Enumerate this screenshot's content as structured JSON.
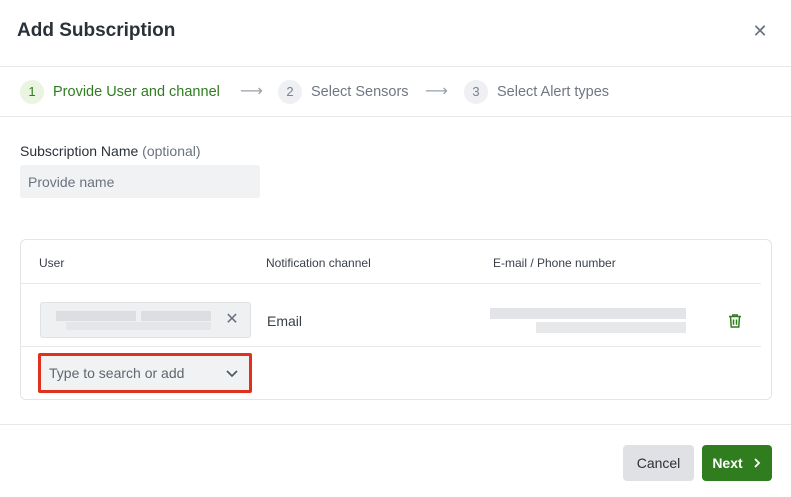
{
  "dialog": {
    "title": "Add Subscription",
    "close_icon": "close-icon"
  },
  "stepper": {
    "steps": [
      {
        "number": "1",
        "label": "Provide User and channel",
        "state": "active"
      },
      {
        "number": "2",
        "label": "Select Sensors",
        "state": "inactive"
      },
      {
        "number": "3",
        "label": "Select Alert types",
        "state": "inactive"
      }
    ],
    "arrow_glyph": "⟶"
  },
  "form": {
    "name_label": "Subscription Name",
    "name_optional": "(optional)",
    "name_value": "",
    "name_placeholder": "Provide name"
  },
  "table": {
    "headers": [
      "User",
      "Notification channel",
      "E-mail / Phone number"
    ],
    "rows": [
      {
        "user": "",
        "channel": "Email",
        "contact": "",
        "delete_icon": "trash-icon"
      }
    ],
    "add_user_placeholder": "Type to search or add"
  },
  "footer": {
    "cancel_label": "Cancel",
    "next_label": "Next"
  },
  "colors": {
    "primary_green": "#2f7d1f",
    "highlight_red": "#e0301e"
  }
}
